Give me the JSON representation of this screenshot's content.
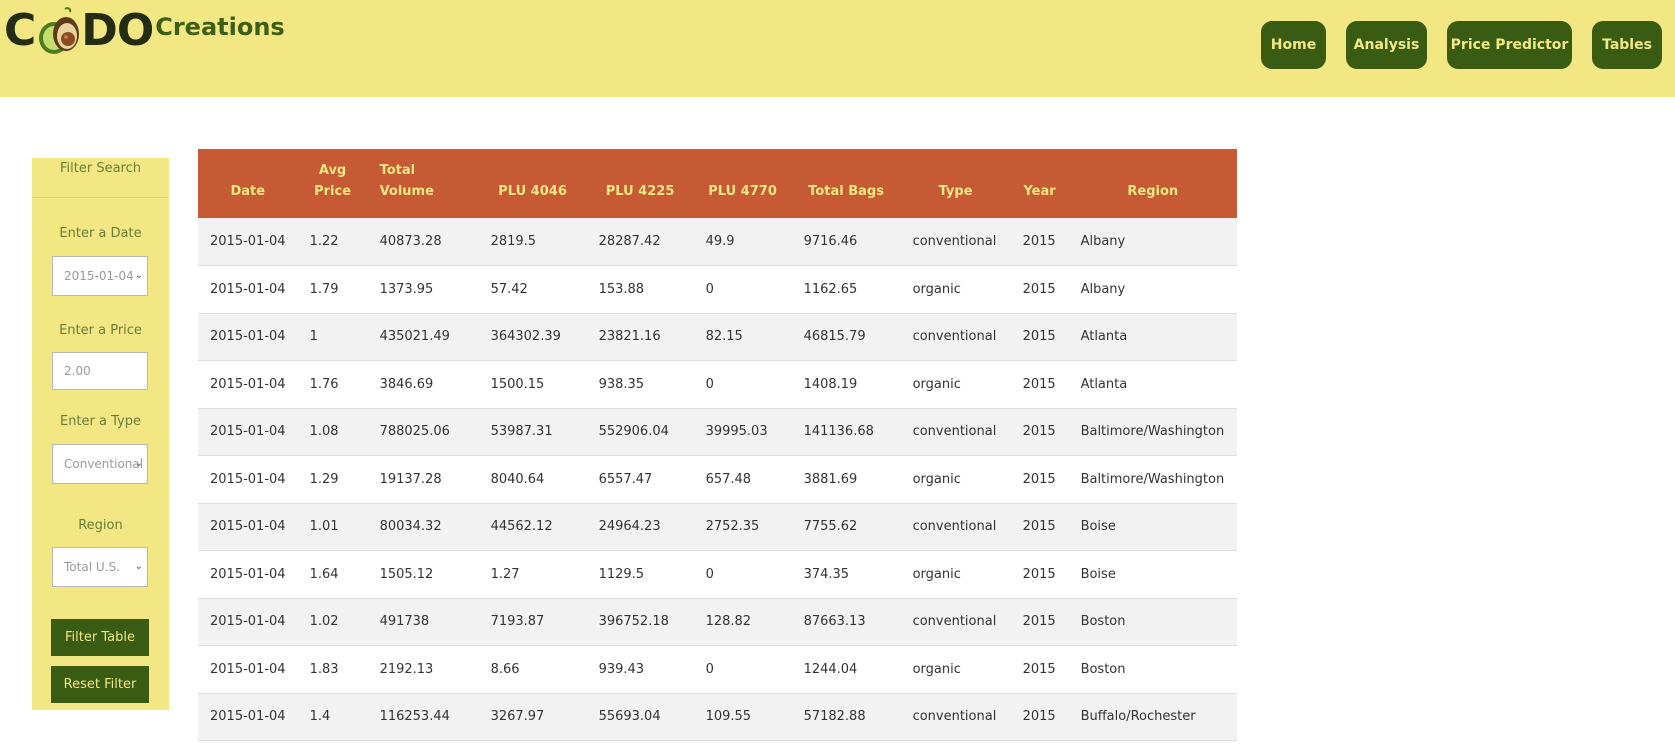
{
  "brand": {
    "logo_prefix": "C",
    "logo_suffix": "DO",
    "subtitle": "Creations"
  },
  "nav": {
    "home": "Home",
    "analysis": "Analysis",
    "price_predictor": "Price Predictor",
    "tables": "Tables"
  },
  "colors": {
    "header_bg": "#f2e783",
    "nav_bg": "#3a5c12",
    "nav_text": "#f2e783",
    "table_header_bg": "#c55a35"
  },
  "sidebar": {
    "title": "Filter Search",
    "date_label": "Enter a Date",
    "date_value": "2015-01-04",
    "price_label": "Enter a Price",
    "price_placeholder": "2.00",
    "type_label": "Enter a Type",
    "type_value": "Conventional",
    "region_label": "Region",
    "region_value": "Total U.S.",
    "filter_button": "Filter Table",
    "reset_button": "Reset Filter"
  },
  "table": {
    "headers": [
      "Date",
      "Avg Price",
      "Total Volume",
      "PLU 4046",
      "PLU 4225",
      "PLU 4770",
      "Total Bags",
      "Type",
      "Year",
      "Region"
    ],
    "rows": [
      [
        "2015-01-04",
        "1.22",
        "40873.28",
        "2819.5",
        "28287.42",
        "49.9",
        "9716.46",
        "conventional",
        "2015",
        "Albany"
      ],
      [
        "2015-01-04",
        "1.79",
        "1373.95",
        "57.42",
        "153.88",
        "0",
        "1162.65",
        "organic",
        "2015",
        "Albany"
      ],
      [
        "2015-01-04",
        "1",
        "435021.49",
        "364302.39",
        "23821.16",
        "82.15",
        "46815.79",
        "conventional",
        "2015",
        "Atlanta"
      ],
      [
        "2015-01-04",
        "1.76",
        "3846.69",
        "1500.15",
        "938.35",
        "0",
        "1408.19",
        "organic",
        "2015",
        "Atlanta"
      ],
      [
        "2015-01-04",
        "1.08",
        "788025.06",
        "53987.31",
        "552906.04",
        "39995.03",
        "141136.68",
        "conventional",
        "2015",
        "Baltimore/Washington"
      ],
      [
        "2015-01-04",
        "1.29",
        "19137.28",
        "8040.64",
        "6557.47",
        "657.48",
        "3881.69",
        "organic",
        "2015",
        "Baltimore/Washington"
      ],
      [
        "2015-01-04",
        "1.01",
        "80034.32",
        "44562.12",
        "24964.23",
        "2752.35",
        "7755.62",
        "conventional",
        "2015",
        "Boise"
      ],
      [
        "2015-01-04",
        "1.64",
        "1505.12",
        "1.27",
        "1129.5",
        "0",
        "374.35",
        "organic",
        "2015",
        "Boise"
      ],
      [
        "2015-01-04",
        "1.02",
        "491738",
        "7193.87",
        "396752.18",
        "128.82",
        "87663.13",
        "conventional",
        "2015",
        "Boston"
      ],
      [
        "2015-01-04",
        "1.83",
        "2192.13",
        "8.66",
        "939.43",
        "0",
        "1244.04",
        "organic",
        "2015",
        "Boston"
      ],
      [
        "2015-01-04",
        "1.4",
        "116253.44",
        "3267.97",
        "55693.04",
        "109.55",
        "57182.88",
        "conventional",
        "2015",
        "Buffalo/Rochester"
      ]
    ]
  }
}
